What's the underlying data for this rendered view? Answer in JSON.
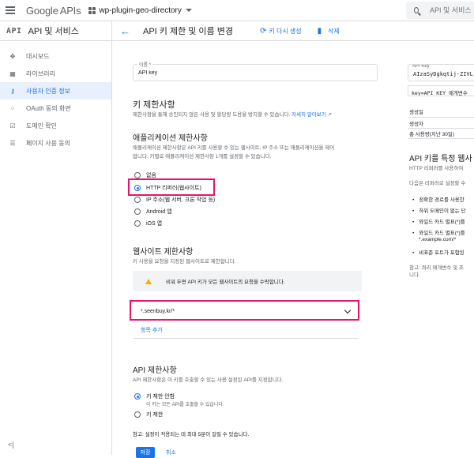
{
  "topbar": {
    "logo_google": "Google",
    "logo_apis": "APIs",
    "project": "wp-plugin-geo-directory",
    "search_placeholder": "API 및 서비스"
  },
  "sidebar": {
    "logo": "API",
    "title": "API 및 서비스",
    "items": [
      {
        "label": "대시보드",
        "icon": "dashboard-icon",
        "glyph": "✥"
      },
      {
        "label": "라이브러리",
        "icon": "library-icon",
        "glyph": "▦"
      },
      {
        "label": "사용자 인증 정보",
        "icon": "key-icon",
        "glyph": "⚷"
      },
      {
        "label": "OAuth 동의 화면",
        "icon": "oauth-icon",
        "glyph": "⁘"
      },
      {
        "label": "도메인 확인",
        "icon": "domain-icon",
        "glyph": "☑"
      },
      {
        "label": "페이지 사용 동의",
        "icon": "settings-icon",
        "glyph": "☰"
      }
    ],
    "active_index": 2,
    "collapse_label": "<|"
  },
  "header": {
    "back_glyph": "←",
    "title": "API 키 제한 및 이름 변경",
    "regenerate_label": "키 다시 생성",
    "delete_label": "삭제"
  },
  "form": {
    "name_label": "이름 *",
    "name_value": "API key",
    "key_restrictions_title": "키 제한사항",
    "key_restrictions_desc": "제한사항을 통해 승인되지 않은 사용 및 할당량 도용을 방지할 수 있습니다.",
    "learn_more": "자세히 알아보기",
    "app_restrictions_title": "애플리케이션 제한사항",
    "app_restrictions_desc_1": "애플리케이션 제한사항은 API 키를 사용할 수 있는 웹사이트, IP 주소 또는 애플리케이션을 제어",
    "app_restrictions_desc_2": "합니다. 키별로 애플리케이션 제한사항 1개를 설정할 수 있습니다.",
    "app_options": [
      "없음",
      "HTTP 리퍼러(웹사이트)",
      "IP 주소(웹 서버, 크론 작업 등)",
      "Android 앱",
      "iOS 앱"
    ],
    "app_selected": 1,
    "web_title": "웹사이트 제한사항",
    "web_desc": "키 사용을 요청을 지정된 웹사이트로 제한합니다.",
    "warning": "비워 두면 API 키가 모든 웹사이트의 요청을 수락합니다.",
    "referrer_value": "*.seenbuy.kr/*",
    "add_item": "항목 추가",
    "api_title": "API 제한사항",
    "api_desc": "API 제한사항은 이 키를 호출할 수 있는 사용 설정된 API를 지정합니다.",
    "api_options": [
      "키 제한 안함",
      "키 제한"
    ],
    "api_option_sub": "이 키는 모든 API를 호출할 수 있습니다.",
    "api_selected": 0,
    "note": "참고: 설정이 적용되는 데 최대 5분이 걸릴 수 있습니다.",
    "save": "저장",
    "cancel": "취소"
  },
  "right": {
    "key_label": "API Key",
    "key_value": "AIzaSyDgkqtij-ZIVL",
    "key_param": "key=API_KEY 매개변수",
    "created": "생성일",
    "creator": "생성자",
    "usage": "총 사용량(지난 30일)",
    "heading": "API 키를 특정 웹사",
    "text1": "HTTP 리퍼러를 사용하여",
    "text2": "다음은 리퍼러로 설정할 수",
    "bullets": [
      "정확한 경로를 사용한",
      "하위 도메인이 없는 단",
      "와일드 카드 별표(*)를",
      "와일드 카드 별표(*)를"
    ],
    "bullet_sub": "*.example.com/*",
    "bullet_last": "비표준 포트가 포함된",
    "note1": "참고: 쿼리 매개변수 및 조",
    "note2": "니다."
  }
}
